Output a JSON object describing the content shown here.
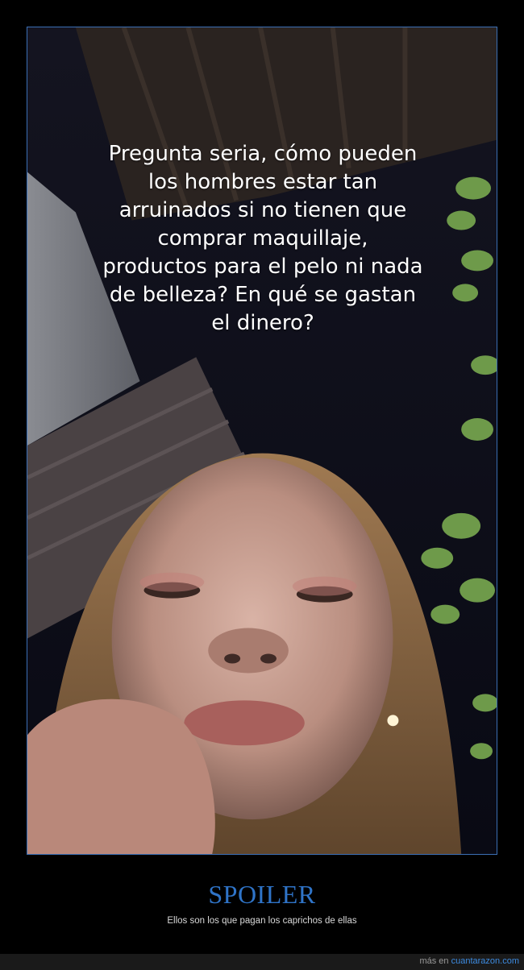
{
  "overlay": {
    "text": "Pregunta seria, cómo pueden\nlos hombres estar tan\narruinados si no tienen que\ncomprar maquillaje,\nproductos para el pelo ni nada\nde belleza? En qué se gastan\nel dinero?"
  },
  "caption": {
    "title": "SPOILER",
    "subtitle": "Ellos son los que pagan los caprichos de ellas"
  },
  "footer": {
    "prefix": "más en",
    "site": "cuantarazon.com"
  },
  "colors": {
    "frame_border": "#3b6fb5",
    "title": "#2f74c8",
    "link": "#3d8be0"
  }
}
